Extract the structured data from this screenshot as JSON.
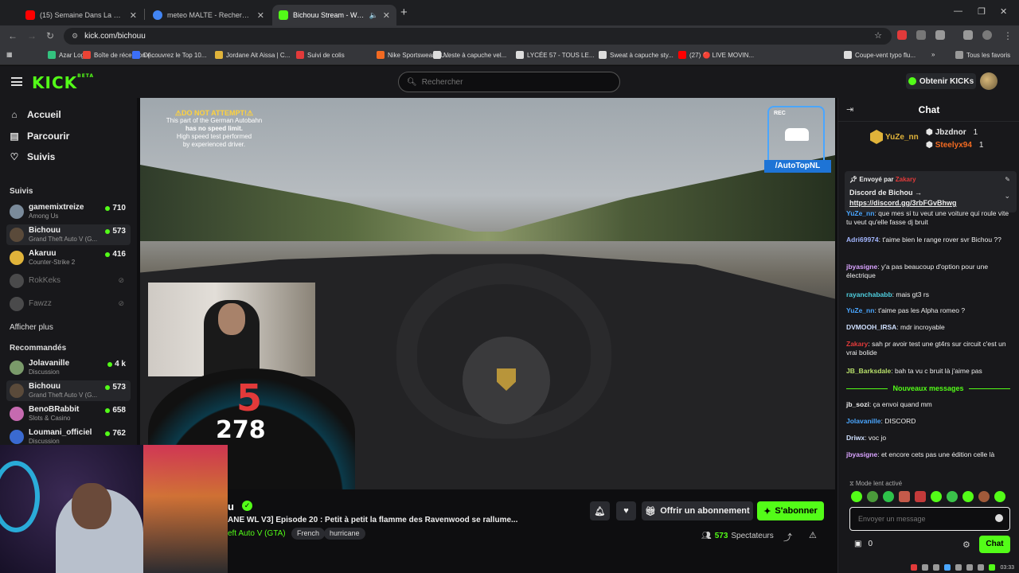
{
  "browser": {
    "tabs": [
      {
        "label": "(15) Semaine Dans La Vie d'un",
        "icon": "youtube-icon",
        "color": "#ff0000"
      },
      {
        "label": "meteo MALTE - Recherche Goo",
        "icon": "google-icon",
        "color": "#4285f4"
      },
      {
        "label": "Bichouu Stream - Watch Li",
        "icon": "kick-icon",
        "color": "#53fc18"
      }
    ],
    "url": "kick.com/bichouu",
    "bookmarks": [
      {
        "label": "Azar Logo",
        "color": "#33c27f"
      },
      {
        "label": "Boîte de réception (...",
        "color": "#ea4335"
      },
      {
        "label": "Découvrez le Top 10...",
        "color": "#3c6ff7"
      },
      {
        "label": "Jordane Ait Aissa | C...",
        "color": "#e0b33a"
      },
      {
        "label": "Suivi de colis",
        "color": "#e23a3a"
      },
      {
        "label": "Nike Sportswear SU...",
        "color": "#f36a21"
      },
      {
        "label": "Veste à capuche vel...",
        "color": "#dddddd"
      },
      {
        "label": "LYCÉE 57 - TOUS LE...",
        "color": "#dddddd"
      },
      {
        "label": "Sweat à capuche sty...",
        "color": "#dddddd"
      },
      {
        "label": "(27) 🔴 LIVE MOVIN...",
        "color": "#ff0000"
      },
      {
        "label": "Coupe-vent typo flu...",
        "color": "#dddddd"
      }
    ],
    "bookmarks_more": "»",
    "all_bookmarks": "Tous les favoris"
  },
  "header": {
    "logo": "KICK",
    "logo_beta": "BETA",
    "search_placeholder": "Rechercher",
    "get_kicks": "Obtenir KICKs"
  },
  "sidebar": {
    "nav": [
      {
        "label": "Accueil",
        "icon": "home-icon"
      },
      {
        "label": "Parcourir",
        "icon": "browse-icon"
      },
      {
        "label": "Suivis",
        "icon": "heart-icon"
      }
    ],
    "following_title": "Suivis",
    "following": [
      {
        "name": "gamemixtreize",
        "game": "Among Us",
        "viewers": "710",
        "color": "#7a8a9a"
      },
      {
        "name": "Bichouu",
        "game": "Grand Theft Auto V (G...",
        "viewers": "573",
        "color": "#5a4a3a"
      },
      {
        "name": "Akaruu",
        "game": "Counter-Strike 2",
        "viewers": "416",
        "color": "#e0b33a"
      },
      {
        "name": "RokKeks",
        "color": "#888888"
      },
      {
        "name": "Fawzz",
        "color": "#888888"
      }
    ],
    "show_more": "Afficher plus",
    "recommended_title": "Recommandés",
    "recommended": [
      {
        "name": "Jolavanille",
        "game": "Discussion",
        "viewers": "4 k",
        "color": "#7a9a6a"
      },
      {
        "name": "Bichouu",
        "game": "Grand Theft Auto V (G...",
        "viewers": "573",
        "color": "#5a4a3a"
      },
      {
        "name": "BenoBRabbit",
        "game": "Slots & Casino",
        "viewers": "658",
        "color": "#c66ab0"
      },
      {
        "name": "Loumani_officiel",
        "game": "Discussion",
        "viewers": "762",
        "color": "#3a6ad0"
      }
    ]
  },
  "video": {
    "warning_title": "⚠DO NOT ATTEMPT!⚠",
    "warning_lines": [
      "This part of the German Autobahn",
      "has no speed limit.",
      "High speed test performed",
      "by experienced driver."
    ],
    "rec_label": "REC",
    "channel_tag": "/AutoTopNL",
    "speed": "278"
  },
  "stream": {
    "name_fragment": "u",
    "title": "ANE WL V3] Episode 20 : Petit à petit la flamme des Ravenwood se rallume...",
    "category": "eft Auto V (GTA)",
    "tags": [
      "French",
      "hurricane"
    ],
    "gift_label": "Offrir un abonnement",
    "subscribe_label": "S'abonner",
    "viewers": "573",
    "viewers_label": "Spectateurs"
  },
  "chat": {
    "title": "Chat",
    "leaders": [
      {
        "name": "YuZe_nn",
        "count": "1",
        "color": "#e0b33a"
      },
      {
        "name": "Jbzdnor",
        "count": "1",
        "color": "#eeeeee"
      },
      {
        "name": "Steelyx94",
        "count": "1",
        "color": "#f36a21"
      }
    ],
    "pinned": {
      "sent_by_label": "Envoyé par",
      "sent_by_user": "Zakary",
      "text": "Discord de Bichou →",
      "link": "https://discord.gg/3rbFGvBhwg"
    },
    "messages": [
      {
        "user": "YuZe_nn",
        "text": "que mes si tu veut une voiture qui roule vite tu veut qu'elle fasse dj bruit",
        "color": "#4aa6ff"
      },
      {
        "user": "Adri69974",
        "text": "t'aime bien le range rover svr Bichou ??",
        "color": "#a3b6ff"
      },
      {
        "user": "jbyasigne",
        "text": "y'a pas beaucoup d'option pour une électrique",
        "color": "#d9a3ff"
      },
      {
        "user": "rayanchababb",
        "text": "mais gt3 rs",
        "color": "#4fd0e0"
      },
      {
        "user": "YuZe_nn",
        "text": "t'aime pas les Alpha romeo ?",
        "color": "#4aa6ff"
      },
      {
        "user": "DVMOOH_IRSA",
        "text": "mdr incroyable",
        "color": "#cfe0ff"
      },
      {
        "user": "Zakary",
        "text": "sah pr avoir test une gt4rs sur circuit c'est un vrai bolide",
        "color": "#e23a3a"
      },
      {
        "user": "JB_Barksdale",
        "text": "bah ta vu c bruit là j'aime pas",
        "color": "#b8e06a"
      }
    ],
    "new_messages": "Nouveaux messages",
    "new": [
      {
        "user": "jb_sozi",
        "text": "ça envoi quand mm",
        "color": "#eeeeee"
      },
      {
        "user": "Jolavanille",
        "text": "DISCORD",
        "color": "#4aa6ff"
      },
      {
        "user": "Driwx",
        "text": "voc jo",
        "color": "#cfe0ff"
      },
      {
        "user": "jbyasigne",
        "text": "et encore cets pas une édition celle là",
        "color": "#d9a3ff"
      }
    ],
    "slow_mode": "Mode lent activé",
    "input_placeholder": "Envoyer un message",
    "points": "0",
    "send_label": "Chat"
  },
  "taskbar": {
    "time": "03:33"
  }
}
